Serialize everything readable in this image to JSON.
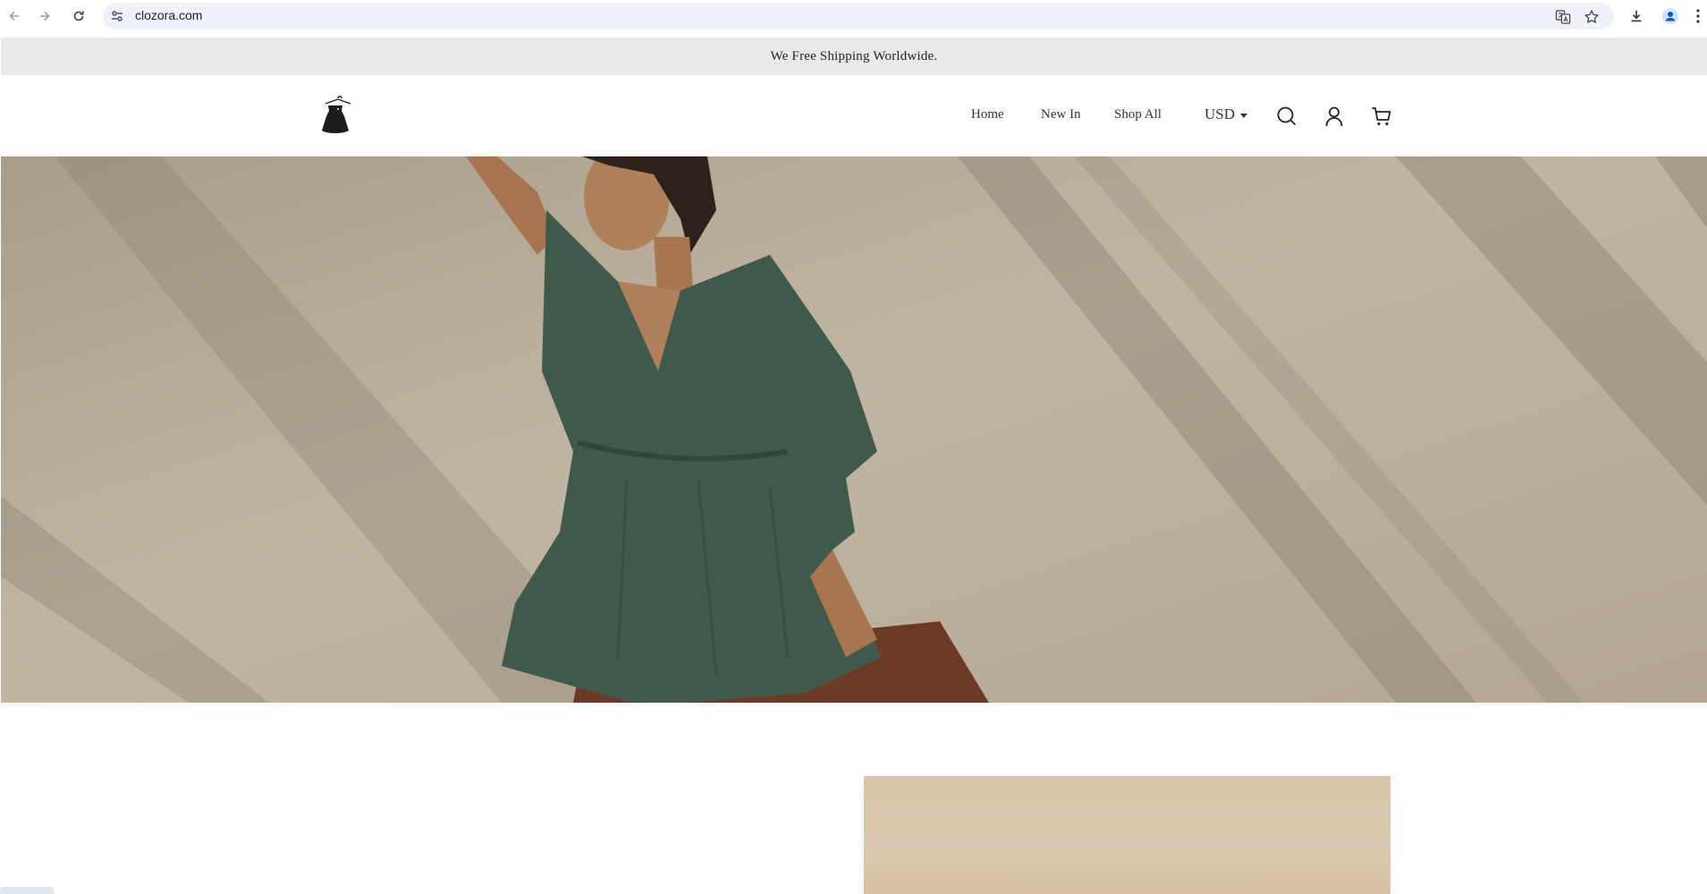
{
  "browser": {
    "url": "clozora.com",
    "icons": [
      "back-arrow-icon",
      "forward-arrow-icon",
      "reload-icon",
      "site-info-icon",
      "translate-icon",
      "bookmark-star-icon",
      "download-icon",
      "profile-icon",
      "more-menu-icon"
    ]
  },
  "announcement": {
    "text": "We Free Shipping Worldwide."
  },
  "header": {
    "logo_icon": "dress-hanger-logo",
    "nav": [
      {
        "label": "Home"
      },
      {
        "label": "New In"
      },
      {
        "label": "Shop All"
      }
    ],
    "currency": "USD",
    "icons": [
      "search-icon",
      "account-icon",
      "cart-icon"
    ]
  },
  "hero": {
    "image": "woman-in-green-blouse-photo"
  },
  "colors": {
    "announcement_bg": "#e9e9e9",
    "hero_wall": "#bcb09f",
    "blouse_green": "#3f5a4b"
  }
}
